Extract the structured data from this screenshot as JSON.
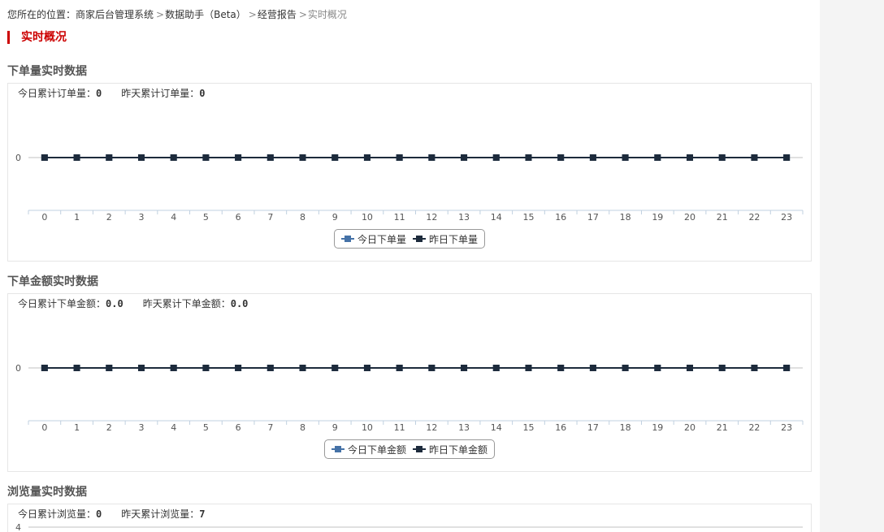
{
  "breadcrumb": {
    "prefix": "您所在的位置：",
    "items": [
      "商家后台管理系统",
      "数据助手（Beta）",
      "经营报告"
    ],
    "current": "实时概况"
  },
  "page_title": "实时概况",
  "colors": {
    "accent": "#c00000",
    "today": "#4572a7",
    "yesterday": "#1d2b3c",
    "axis": "#c0d0e0",
    "grid": "#c0c0c0"
  },
  "sections": [
    {
      "title": "下单量实时数据",
      "summary": [
        {
          "label": "今日累计订单量：",
          "value": "0"
        },
        {
          "label": "昨天累计订单量：",
          "value": "0"
        }
      ],
      "legend": [
        {
          "label": "今日下单量",
          "icon": "series-today-icon"
        },
        {
          "label": "昨日下单量",
          "icon": "series-yesterday-icon"
        }
      ]
    },
    {
      "title": "下单金额实时数据",
      "summary": [
        {
          "label": "今日累计下单金额：",
          "value": "0.0"
        },
        {
          "label": "昨天累计下单金额：",
          "value": "0.0"
        }
      ],
      "legend": [
        {
          "label": "今日下单金额",
          "icon": "series-today-icon"
        },
        {
          "label": "昨日下单金额",
          "icon": "series-yesterday-icon"
        }
      ]
    },
    {
      "title": "浏览量实时数据",
      "summary": [
        {
          "label": "今日累计浏览量：",
          "value": "0"
        },
        {
          "label": "昨天累计浏览量：",
          "value": "7"
        }
      ]
    }
  ],
  "chart_data": [
    {
      "type": "line",
      "x": [
        0,
        1,
        2,
        3,
        4,
        5,
        6,
        7,
        8,
        9,
        10,
        11,
        12,
        13,
        14,
        15,
        16,
        17,
        18,
        19,
        20,
        21,
        22,
        23
      ],
      "yticks": [
        0
      ],
      "series": [
        {
          "name": "今日下单量",
          "values": [
            0,
            0,
            0,
            0,
            0,
            0,
            0,
            0,
            0,
            0,
            0,
            0,
            0,
            0,
            0,
            0,
            0,
            0,
            0,
            0,
            0,
            0,
            0,
            0
          ]
        },
        {
          "name": "昨日下单量",
          "values": [
            0,
            0,
            0,
            0,
            0,
            0,
            0,
            0,
            0,
            0,
            0,
            0,
            0,
            0,
            0,
            0,
            0,
            0,
            0,
            0,
            0,
            0,
            0,
            0
          ]
        }
      ],
      "legend": "bottom-center"
    },
    {
      "type": "line",
      "x": [
        0,
        1,
        2,
        3,
        4,
        5,
        6,
        7,
        8,
        9,
        10,
        11,
        12,
        13,
        14,
        15,
        16,
        17,
        18,
        19,
        20,
        21,
        22,
        23
      ],
      "yticks": [
        0
      ],
      "series": [
        {
          "name": "今日下单金额",
          "values": [
            0,
            0,
            0,
            0,
            0,
            0,
            0,
            0,
            0,
            0,
            0,
            0,
            0,
            0,
            0,
            0,
            0,
            0,
            0,
            0,
            0,
            0,
            0,
            0
          ]
        },
        {
          "name": "昨日下单金额",
          "values": [
            0,
            0,
            0,
            0,
            0,
            0,
            0,
            0,
            0,
            0,
            0,
            0,
            0,
            0,
            0,
            0,
            0,
            0,
            0,
            0,
            0,
            0,
            0,
            0
          ]
        }
      ],
      "legend": "bottom-center"
    },
    {
      "type": "line",
      "yticks": [
        4
      ],
      "series": []
    }
  ]
}
